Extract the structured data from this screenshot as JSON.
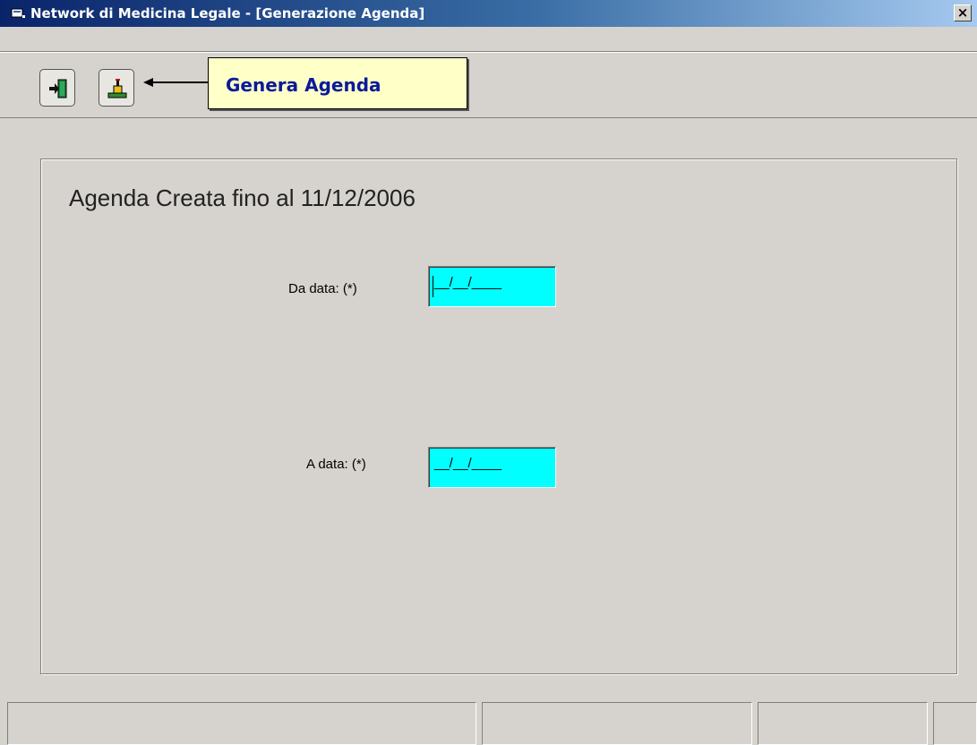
{
  "window": {
    "title": "Network di Medicina Legale - [Generazione Agenda]",
    "close_label": "×"
  },
  "toolbar": {
    "buttons": [
      {
        "name": "exit",
        "icon": "exit-door-icon"
      },
      {
        "name": "generate",
        "icon": "generate-agenda-icon"
      }
    ],
    "callout_text": "Genera Agenda"
  },
  "panel": {
    "title": "Agenda Creata fino al 11/12/2006",
    "from_label": "Da data: (*)",
    "from_value": "__/__/____",
    "to_label": "A data: (*)",
    "to_value": "__/__/____"
  },
  "colors": {
    "input_bg": "#00ffff",
    "callout_bg": "#ffffc8",
    "callout_text": "#0a1a9a"
  }
}
